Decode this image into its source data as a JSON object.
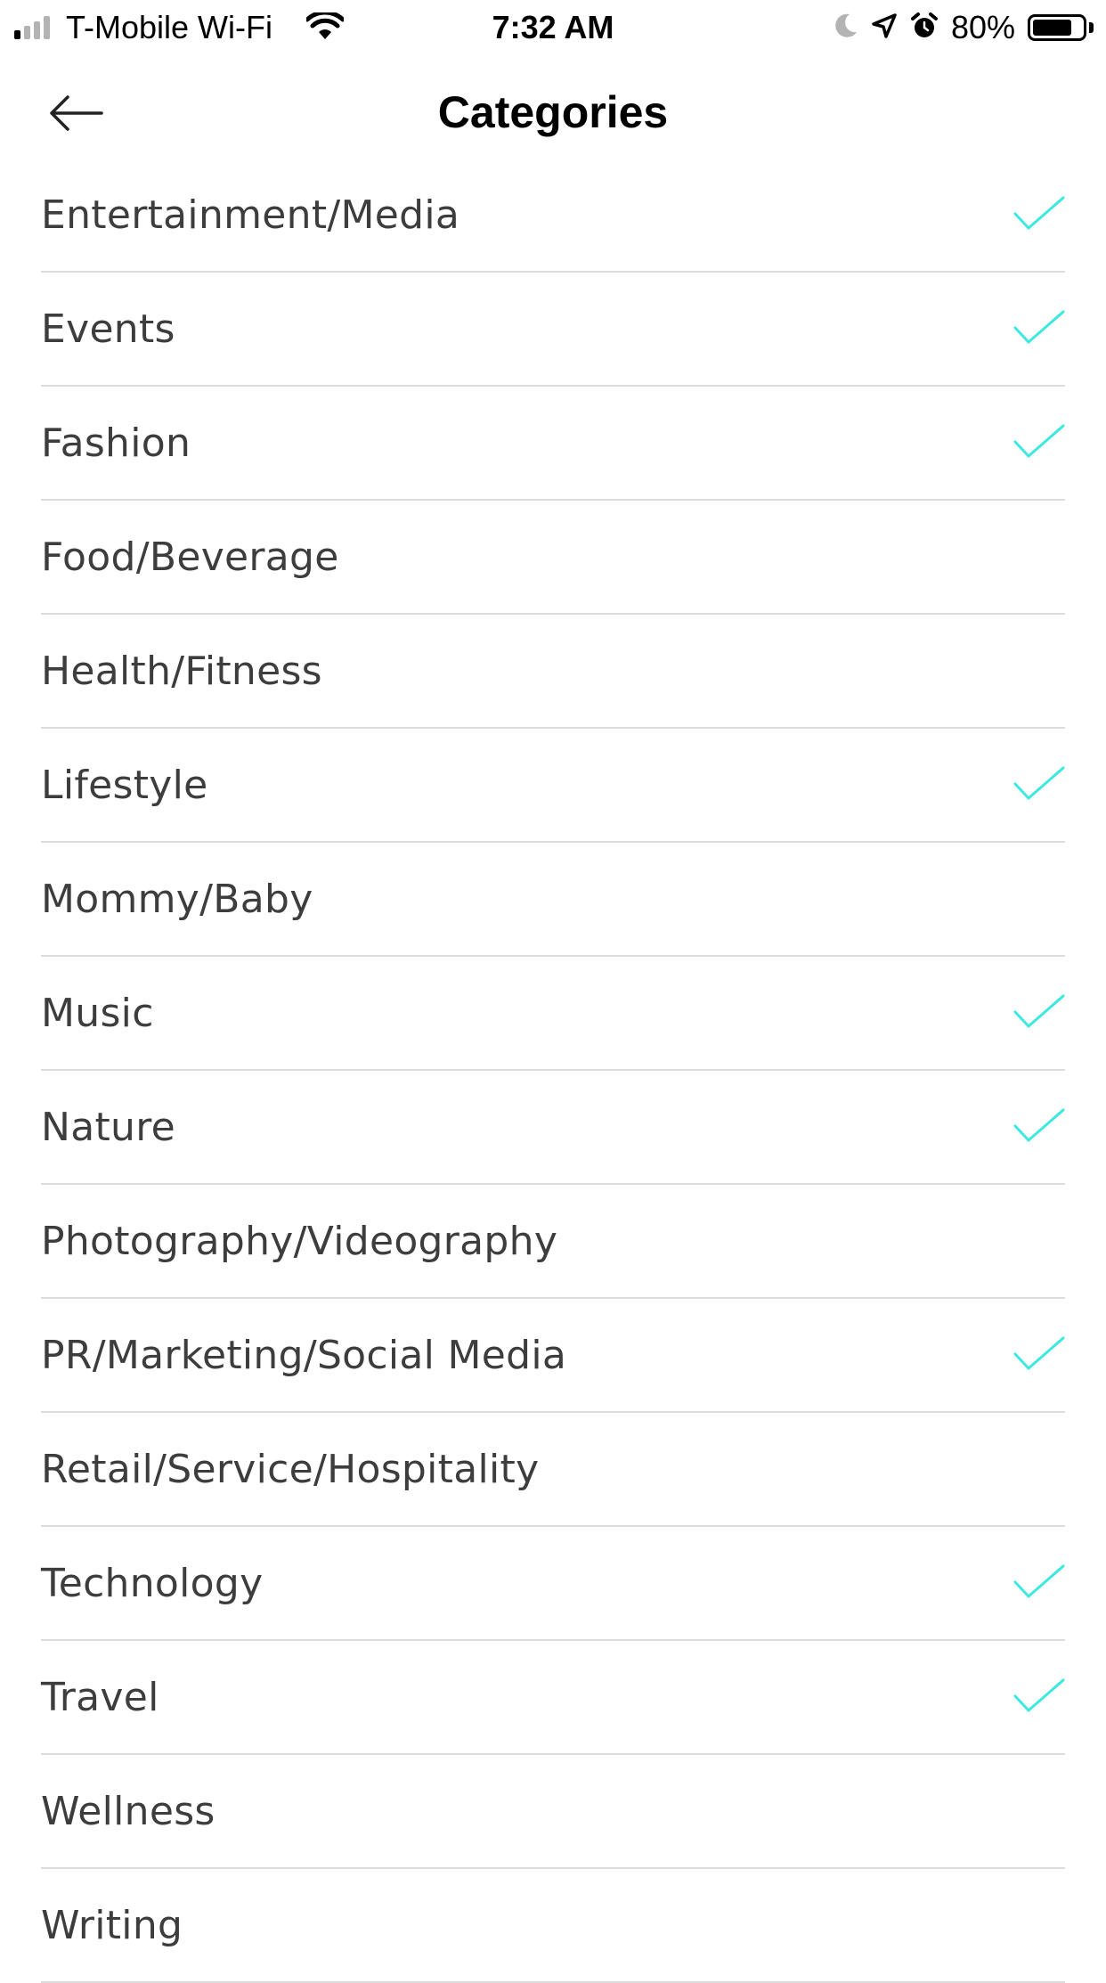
{
  "status_bar": {
    "carrier": "T-Mobile Wi-Fi",
    "time": "7:32 AM",
    "battery_percent": "80%",
    "battery_level": 0.8,
    "signal_bars": 4,
    "signal_bars_active": 1,
    "icons": [
      "signal-icon",
      "wifi-icon",
      "moon-icon",
      "location-arrow-icon",
      "alarm-icon",
      "battery-icon"
    ]
  },
  "header": {
    "title": "Categories",
    "back_icon": "arrow-left-icon"
  },
  "colors": {
    "check": "#3de8de",
    "divider": "#dcdcdc",
    "label": "#3d3d3d",
    "title": "#000000"
  },
  "categories": [
    {
      "label": "Entertainment/Media",
      "checked": true
    },
    {
      "label": "Events",
      "checked": true
    },
    {
      "label": "Fashion",
      "checked": true
    },
    {
      "label": "Food/Beverage",
      "checked": false
    },
    {
      "label": "Health/Fitness",
      "checked": false
    },
    {
      "label": "Lifestyle",
      "checked": true
    },
    {
      "label": "Mommy/Baby",
      "checked": false
    },
    {
      "label": "Music",
      "checked": true
    },
    {
      "label": "Nature",
      "checked": true
    },
    {
      "label": "Photography/Videography",
      "checked": false
    },
    {
      "label": "PR/Marketing/Social Media",
      "checked": true
    },
    {
      "label": "Retail/Service/Hospitality",
      "checked": false
    },
    {
      "label": "Technology",
      "checked": true
    },
    {
      "label": "Travel",
      "checked": true
    },
    {
      "label": "Wellness",
      "checked": false
    },
    {
      "label": "Writing",
      "checked": false
    }
  ]
}
